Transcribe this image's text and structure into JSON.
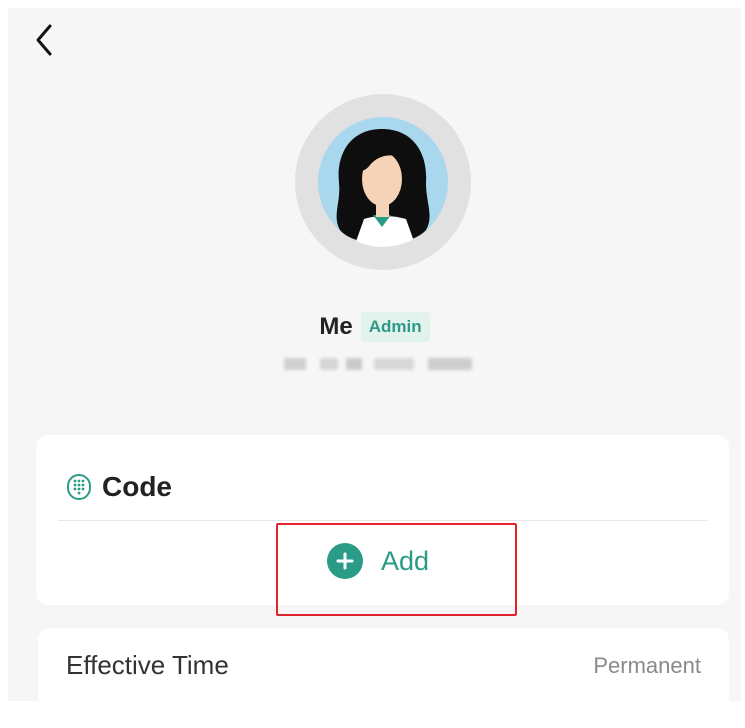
{
  "nav": {
    "back_icon": "chevron-left-icon"
  },
  "profile": {
    "name": "Me",
    "role_badge": "Admin",
    "avatar_icon": "woman-avatar-icon",
    "subtitle_obscured": true
  },
  "code_section": {
    "title": "Code",
    "title_icon": "keypad-icon",
    "add_label": "Add",
    "add_icon": "plus-circle-icon"
  },
  "effective_time": {
    "label": "Effective Time",
    "value": "Permanent"
  },
  "colors": {
    "accent": "#2a9b86",
    "badge_bg": "#e2f3ee",
    "highlight": "#e0242e",
    "page_bg": "#f6f6f6"
  }
}
